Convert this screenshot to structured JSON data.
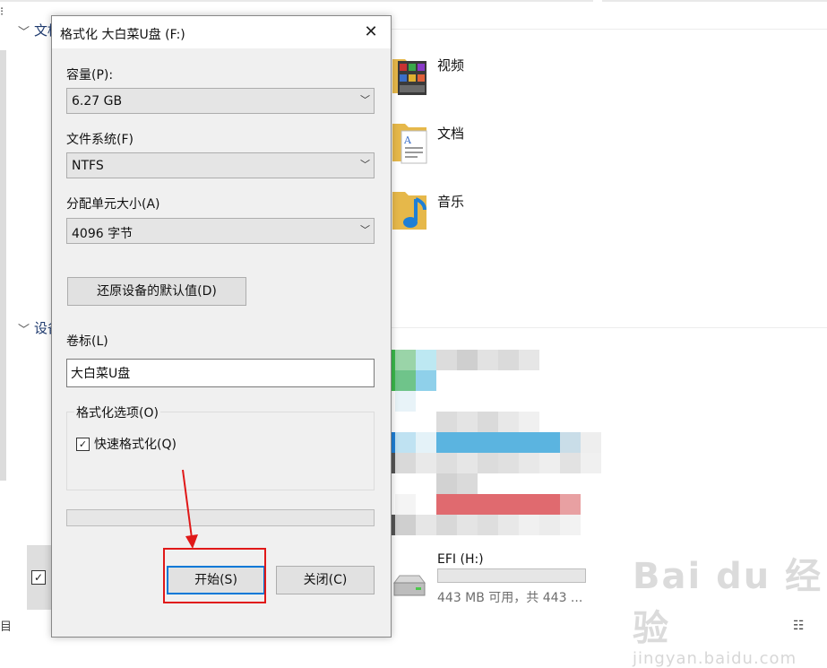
{
  "explorer": {
    "section_folders_label": "文档",
    "section_devices_label": "设备",
    "folders": [
      {
        "name": "视频",
        "icon": "video-folder-icon"
      },
      {
        "name": "文档",
        "icon": "documents-folder-icon"
      },
      {
        "name": "音乐",
        "icon": "music-folder-icon"
      }
    ],
    "drive": {
      "name": "EFI (H:)",
      "info": "443 MB 可用，共 443 ...",
      "used_fraction": 0.0
    }
  },
  "dialog": {
    "title": "格式化 大白菜U盘 (F:)",
    "close_glyph": "✕",
    "capacity": {
      "label": "容量(P):",
      "value": "6.27 GB"
    },
    "filesystem": {
      "label": "文件系统(F)",
      "value": "NTFS"
    },
    "allocation": {
      "label": "分配单元大小(A)",
      "value": "4096 字节"
    },
    "restore_defaults_label": "还原设备的默认值(D)",
    "volume_label": {
      "label": "卷标(L)",
      "value": "大白菜U盘"
    },
    "format_options": {
      "title": "格式化选项(O)",
      "quick_format_label": "快速格式化(Q)",
      "quick_format_checked": true
    },
    "progress_fraction": 0.0,
    "start_label": "开始(S)",
    "close_label": "关闭(C)"
  },
  "watermark": {
    "main": "Bai du 经验",
    "sub": "jingyan.baidu.com"
  },
  "colors": {
    "accent": "#0078d7",
    "annotation_red": "#e01818",
    "mosaic_blue": "#5bb4e0",
    "mosaic_red": "#e06a6f"
  }
}
